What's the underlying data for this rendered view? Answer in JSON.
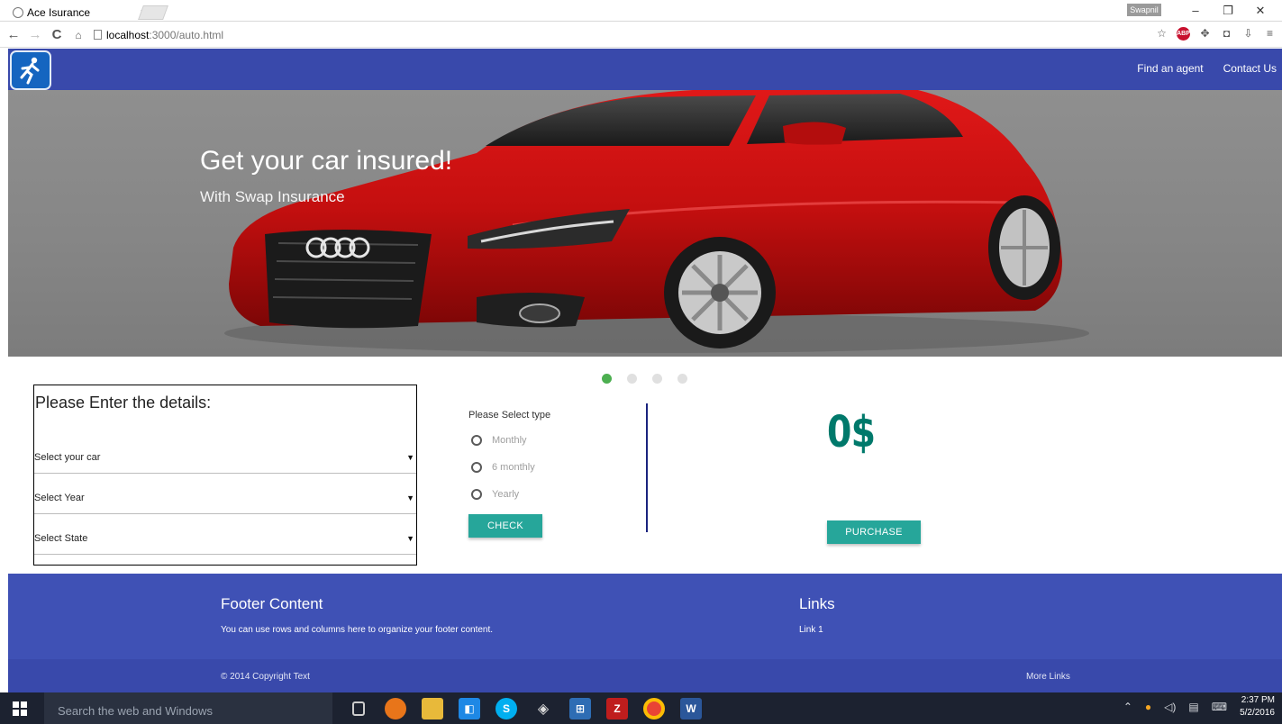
{
  "browser": {
    "tab_title": "Ace Isurance",
    "tab_close": "×",
    "profile_name": "Swapnil",
    "url_host": "localhost",
    "url_path": ":3000/auto.html",
    "window_controls": [
      "–",
      "❐",
      "✕"
    ]
  },
  "navbar": {
    "color": "#3949ab",
    "links": [
      "Find an agent",
      "Contact Us"
    ]
  },
  "hero": {
    "title": "Get your car insured!",
    "subtitle": "With Swap Insurance",
    "slides_total": 4,
    "active_slide": 1
  },
  "details_form": {
    "title": "Please Enter the details:",
    "selects": [
      {
        "label": "Select your car"
      },
      {
        "label": "Select Year"
      },
      {
        "label": "Select State"
      }
    ]
  },
  "plan": {
    "label": "Please Select type",
    "options": [
      "Monthly",
      "6 monthly",
      "Yearly"
    ],
    "check_label": "CHECK"
  },
  "quote": {
    "price": "0$",
    "purchase_label": "PURCHASE"
  },
  "footer": {
    "heading": "Footer Content",
    "text": "You can use rows and columns here to organize your footer content.",
    "links_heading": "Links",
    "link_1": "Link 1",
    "copyright": "© 2014 Copyright Text",
    "more_links": "More Links"
  },
  "taskbar": {
    "search_placeholder": "Search the web and Windows",
    "time": "2:37 PM",
    "date": "5/2/2016"
  },
  "colors": {
    "accent_teal": "#26a69a",
    "price_teal": "#00796b",
    "indicator_active": "#4caf50",
    "car_red": "#c40f0f"
  }
}
